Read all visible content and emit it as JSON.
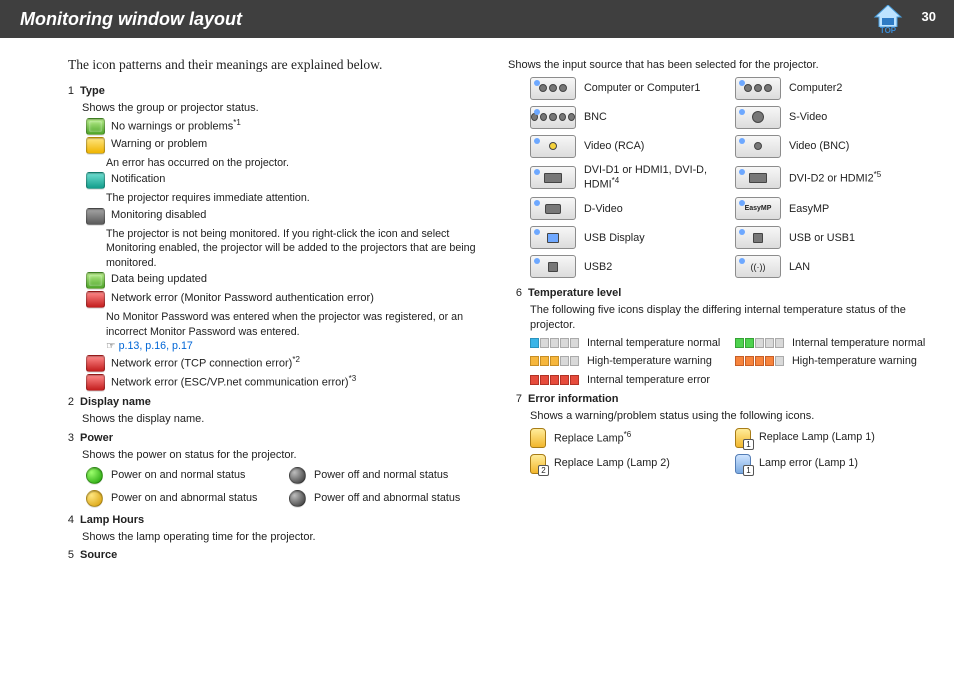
{
  "header": {
    "title": "Monitoring window layout",
    "page": "30",
    "top": "TOP"
  },
  "intro": "The icon patterns and their meanings are explained below.",
  "s1": {
    "num": "1",
    "title": "Type",
    "desc": "Shows the group or projector status.",
    "i1": "No warnings or problems",
    "i1s": "*1",
    "i2": "Warning or problem",
    "n2": "An error has occurred on the projector.",
    "i3": "Notification",
    "n3": "The projector requires immediate attention.",
    "i4": "Monitoring disabled",
    "n4": "The projector is not being monitored. If you right-click the icon and select Monitoring enabled, the projector will be added to the projectors that are being monitored.",
    "i5": "Data being updated",
    "i6": "Network error (Monitor Password authentication error)",
    "n6": "No Monitor Password was entered when the projector was registered, or an incorrect Monitor Password was entered.",
    "links": "p.13, p.16, p.17",
    "i7": "Network error (TCP connection error)",
    "i7s": "*2",
    "i8": "Network error (ESC/VP.net communication error)",
    "i8s": "*3"
  },
  "s2": {
    "num": "2",
    "title": "Display name",
    "desc": "Shows the display name."
  },
  "s3": {
    "num": "3",
    "title": "Power",
    "desc": "Shows the power on status for the projector.",
    "p1": "Power on and normal status",
    "p2": "Power off and normal status",
    "p3": "Power on and abnormal status",
    "p4": "Power off and abnormal status"
  },
  "s4": {
    "num": "4",
    "title": "Lamp Hours",
    "desc": "Shows the lamp operating time for the projector."
  },
  "s5": {
    "num": "5",
    "title": "Source",
    "desc": "Shows the input source that has been selected for the projector.",
    "a": "Computer or Computer1",
    "b": "Computer2",
    "c": "BNC",
    "d": "S-Video",
    "e": "Video (RCA)",
    "f": "Video (BNC)",
    "g": "DVI-D1 or HDMI1, DVI-D, HDMI",
    "gs": "*4",
    "h": "DVI-D2 or HDMI2",
    "hs": "*5",
    "i": "D-Video",
    "j": "EasyMP",
    "k": "USB Display",
    "l": "USB or USB1",
    "m": "USB2",
    "n": "LAN"
  },
  "s6": {
    "num": "6",
    "title": "Temperature level",
    "desc": "The following five icons display the differing internal temperature status of the projector.",
    "t1": "Internal temperature normal",
    "t2": "Internal temperature normal",
    "t3": "High-temperature warning",
    "t4": "High-temperature warning",
    "t5": "Internal temperature error"
  },
  "s7": {
    "num": "7",
    "title": "Error information",
    "desc": "Shows a warning/problem status using the following icons.",
    "e1": "Replace Lamp",
    "e1s": "*6",
    "e2": "Replace Lamp (Lamp 1)",
    "e3": "Replace Lamp (Lamp 2)",
    "e4": "Lamp error (Lamp 1)"
  }
}
